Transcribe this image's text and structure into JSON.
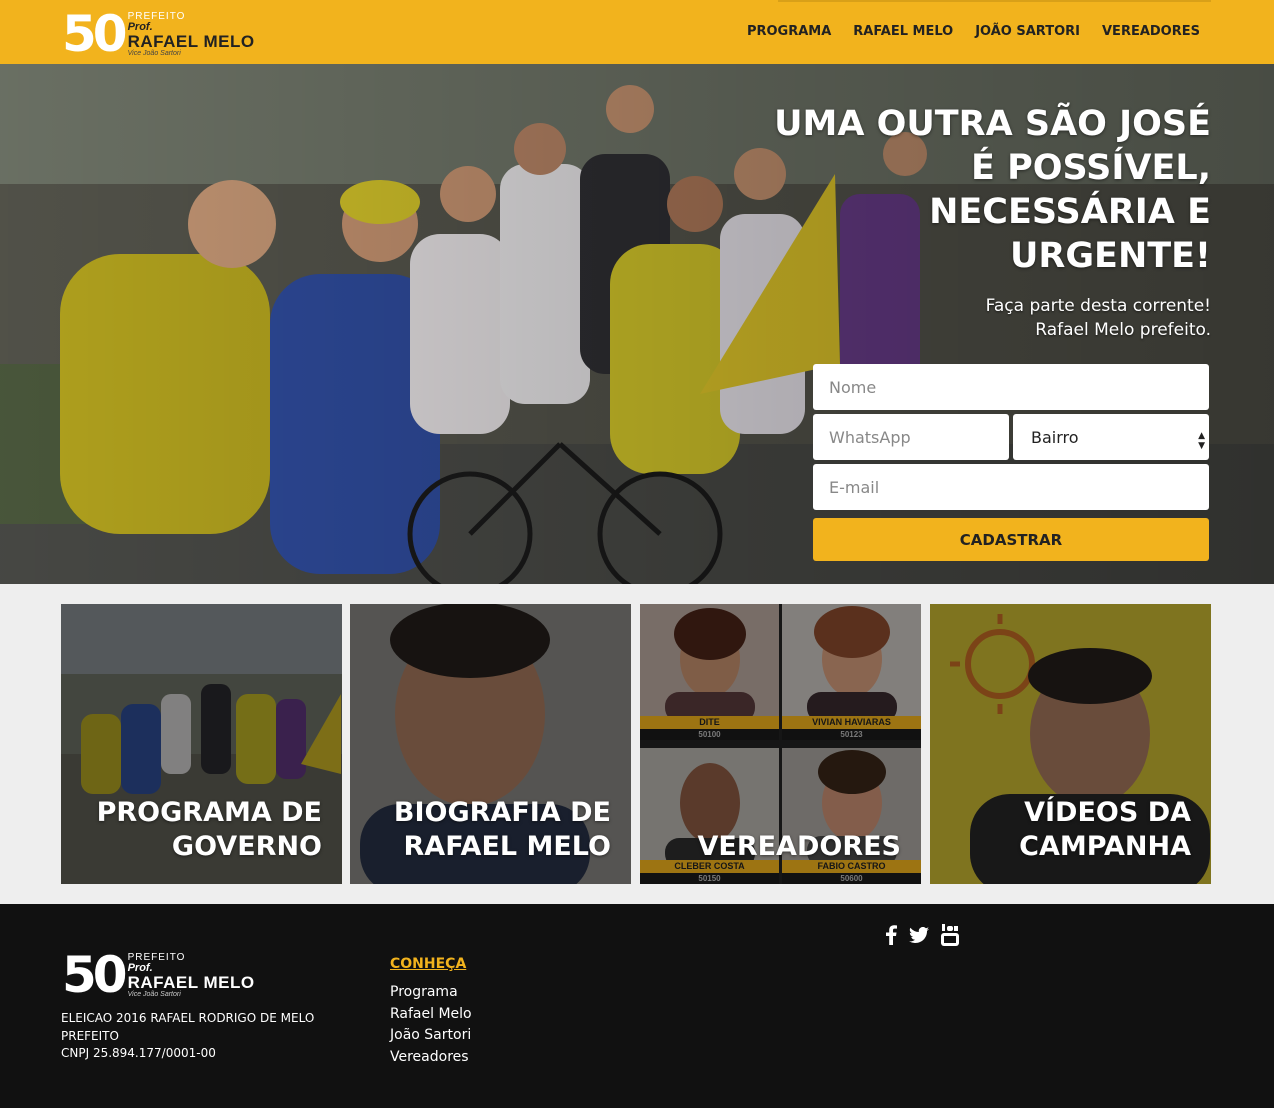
{
  "header": {
    "logo": {
      "number": "50",
      "line1": "PREFEITO",
      "line2": "Prof.",
      "line3": "RAFAEL MELO",
      "line4": "Vice João Sartori"
    },
    "nav": [
      "PROGRAMA",
      "RAFAEL MELO",
      "JOÃO SARTORI",
      "VEREADORES"
    ]
  },
  "hero": {
    "title_lines": [
      "UMA OUTRA SÃO JOSÉ",
      "É POSSÍVEL,",
      "NECESSÁRIA E",
      "URGENTE!"
    ],
    "subtitle_lines": [
      "Faça parte desta corrente!",
      "Rafael Melo prefeito."
    ],
    "form": {
      "name_placeholder": "Nome",
      "whatsapp_placeholder": "WhatsApp",
      "bairro_selected": "Bairro",
      "email_placeholder": "E-mail",
      "submit_label": "CADASTRAR"
    }
  },
  "cards": [
    {
      "lines": [
        "PROGRAMA DE",
        "GOVERNO"
      ]
    },
    {
      "lines": [
        "BIOGRAFIA DE",
        "RAFAEL MELO"
      ]
    },
    {
      "lines": [
        "VEREADORES"
      ],
      "candidates": [
        {
          "name": "DITE",
          "number": "50100"
        },
        {
          "name": "VIVIAN HAVIARAS",
          "number": "50123"
        },
        {
          "name": "CLEBER COSTA",
          "number": "50150"
        },
        {
          "name": "FABIO CASTRO",
          "number": "50600"
        }
      ]
    },
    {
      "lines": [
        "VÍDEOS DA",
        "CAMPANHA"
      ]
    }
  ],
  "footer": {
    "logo": {
      "number": "50",
      "line1": "PREFEITO",
      "line2": "Prof.",
      "line3": "RAFAEL MELO",
      "line4": "Vice João Sartori"
    },
    "legal_lines": [
      "ELEICAO 2016 RAFAEL RODRIGO DE MELO",
      "PREFEITO",
      "CNPJ 25.894.177/0001-00"
    ],
    "conheca": {
      "heading": "CONHEÇA",
      "links": [
        "Programa",
        "Rafael Melo",
        "João Sartori",
        "Vereadores"
      ]
    },
    "social_icons": [
      "facebook-icon",
      "twitter-icon",
      "youtube-icon"
    ]
  },
  "colors": {
    "accent": "#f2b31d",
    "footer_bg": "#111111",
    "page_bg": "#eeeeee"
  }
}
